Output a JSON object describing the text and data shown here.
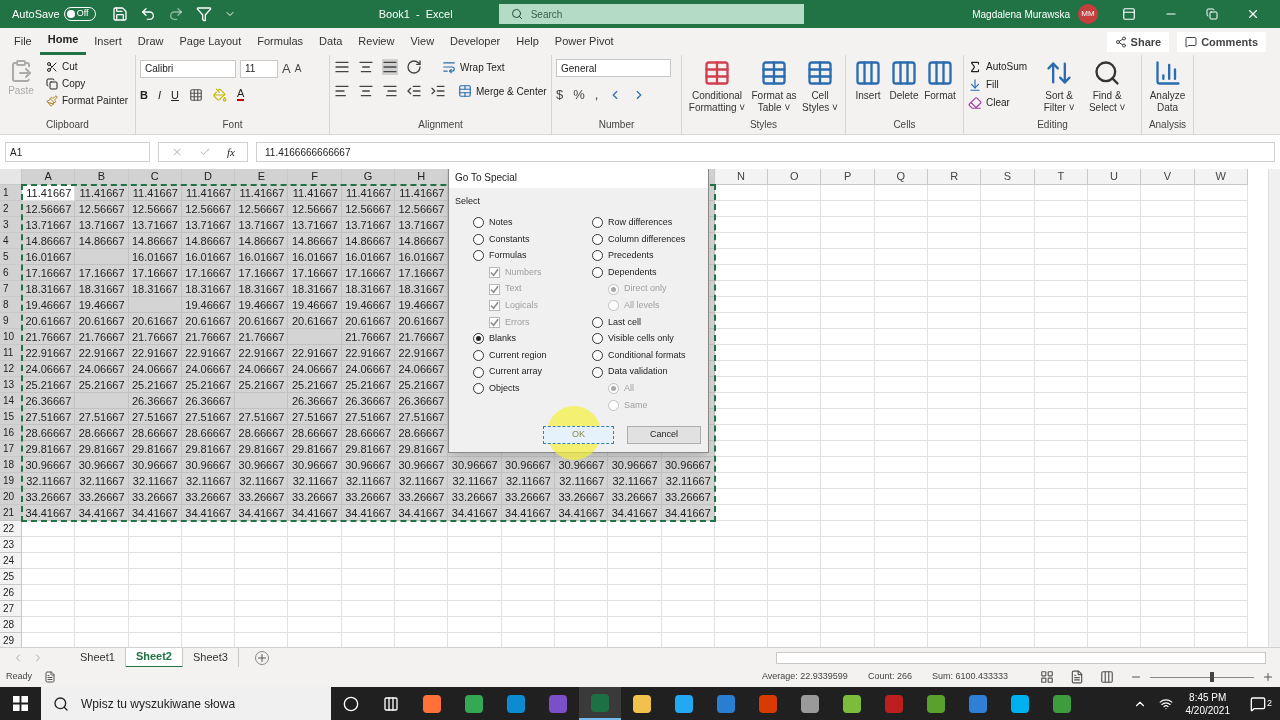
{
  "title_bar": {
    "autosave": "AutoSave",
    "toggle": {
      "label": "Off",
      "on": false
    },
    "title": "Book1  -  Excel",
    "search": {
      "placeholder": "Search"
    },
    "user": "Magdalena Murawska",
    "avatar": "MM"
  },
  "menu_tabs": [
    {
      "label": "File",
      "selected": false
    },
    {
      "label": "Home",
      "selected": true
    },
    {
      "label": "Insert",
      "selected": false
    },
    {
      "label": "Draw",
      "selected": false
    },
    {
      "label": "Page Layout",
      "selected": false
    },
    {
      "label": "Formulas",
      "selected": false
    },
    {
      "label": "Data",
      "selected": false
    },
    {
      "label": "Review",
      "selected": false
    },
    {
      "label": "View",
      "selected": false
    },
    {
      "label": "Developer",
      "selected": false
    },
    {
      "label": "Help",
      "selected": false
    },
    {
      "label": "Power Pivot",
      "selected": false
    }
  ],
  "share": "Share",
  "comments": "Comments",
  "clipboard": {
    "label": "Clipboard",
    "paste": {
      "label": "Paste",
      "disabled": true
    },
    "cut": "Cut",
    "copy": "Copy",
    "format_painter": "Format Painter"
  },
  "font": {
    "label": "Font",
    "family": "Calibri",
    "size": "11",
    "grow": "A",
    "shrink": "A",
    "bold": "B",
    "italic": "I",
    "underline": "U",
    "font_color_letter": "A"
  },
  "alignment": {
    "label": "Alignment",
    "wrap": "Wrap Text",
    "merge": "Merge & Center"
  },
  "number": {
    "label": "Number",
    "format": "General",
    "symbols": [
      "$",
      "%",
      ","
    ]
  },
  "styles": {
    "label": "Styles",
    "buttons": [
      "Conditional Formatting ˅",
      "Format as Table ˅",
      "Cell Styles ˅"
    ]
  },
  "cells": {
    "label": "Cells",
    "buttons": [
      "Insert",
      "Delete",
      "Format"
    ]
  },
  "editing": {
    "label": "Editing",
    "autosum": "AutoSum",
    "fill": "Fill",
    "clear": "Clear",
    "buttons": [
      "Sort & Filter ˅",
      "Find & Select ˅"
    ]
  },
  "analysis": {
    "label": "Analysis",
    "buttons": [
      "Analyze Data"
    ]
  },
  "formula_bar": {
    "name_box": "A1",
    "fx": "fx",
    "formula": "11.4166666666667"
  },
  "columns": [
    {
      "label": "A",
      "selected": true
    },
    {
      "label": "B",
      "selected": true
    },
    {
      "label": "C",
      "selected": true
    },
    {
      "label": "D",
      "selected": true
    },
    {
      "label": "E",
      "selected": true
    },
    {
      "label": "F",
      "selected": true
    },
    {
      "label": "G",
      "selected": true
    },
    {
      "label": "H",
      "selected": true
    },
    {
      "selected": true
    },
    {
      "selected": true
    },
    {
      "selected": true
    },
    {
      "selected": true
    },
    {
      "selected": true
    },
    {
      "label": "N",
      "selected": false
    },
    {
      "label": "O",
      "selected": false
    },
    {
      "label": "P",
      "selected": false
    },
    {
      "label": "Q",
      "selected": false
    },
    {
      "label": "R",
      "selected": false
    },
    {
      "label": "S",
      "selected": false
    },
    {
      "label": "T",
      "selected": false
    },
    {
      "label": "U",
      "selected": false
    },
    {
      "label": "V",
      "selected": false
    },
    {
      "label": "W",
      "selected": false
    }
  ],
  "rows": [
    {
      "number": "1",
      "selected": true,
      "cells": [
        {
          "value": "11.41667",
          "active": true
        },
        "11.41667",
        "11.41667",
        "11.41667",
        "11.41667",
        "11.41667",
        "11.41667",
        "11.41667"
      ]
    },
    {
      "number": "2",
      "selected": true,
      "cells": [
        "12.56667",
        "12.56667",
        "12.56667",
        "12.56667",
        "12.56667",
        "12.56667",
        "12.56667",
        "12.56667"
      ]
    },
    {
      "number": "3",
      "selected": true,
      "cells": [
        "13.71667",
        "13.71667",
        "13.71667",
        "13.71667",
        "13.71667",
        "13.71667",
        "13.71667",
        "13.71667"
      ]
    },
    {
      "number": "4",
      "selected": true,
      "cells": [
        "14.86667",
        "14.86667",
        "14.86667",
        "14.86667",
        "14.86667",
        "14.86667",
        "14.86667",
        "14.86667"
      ]
    },
    {
      "number": "5",
      "selected": true,
      "cells": [
        "16.01667",
        null,
        "16.01667",
        "16.01667",
        "16.01667",
        "16.01667",
        "16.01667",
        "16.01667"
      ]
    },
    {
      "number": "6",
      "selected": true,
      "cells": [
        "17.16667",
        "17.16667",
        "17.16667",
        "17.16667",
        "17.16667",
        "17.16667",
        "17.16667",
        "17.16667"
      ]
    },
    {
      "number": "7",
      "selected": true,
      "cells": [
        "18.31667",
        "18.31667",
        "18.31667",
        "18.31667",
        "18.31667",
        "18.31667",
        "18.31667",
        "18.31667"
      ]
    },
    {
      "number": "8",
      "selected": true,
      "cells": [
        "19.46667",
        "19.46667",
        null,
        "19.46667",
        "19.46667",
        "19.46667",
        "19.46667",
        "19.46667"
      ]
    },
    {
      "number": "9",
      "selected": true,
      "cells": [
        "20.61667",
        "20.61667",
        "20.61667",
        "20.61667",
        "20.61667",
        "20.61667",
        "20.61667",
        "20.61667"
      ]
    },
    {
      "number": "10",
      "selected": true,
      "cells": [
        "21.76667",
        "21.76667",
        "21.76667",
        "21.76667",
        "21.76667",
        null,
        "21.76667",
        "21.76667"
      ]
    },
    {
      "number": "11",
      "selected": true,
      "cells": [
        "22.91667",
        "22.91667",
        "22.91667",
        "22.91667",
        "22.91667",
        "22.91667",
        "22.91667",
        "22.91667"
      ]
    },
    {
      "number": "12",
      "selected": true,
      "cells": [
        "24.06667",
        "24.06667",
        "24.06667",
        "24.06667",
        "24.06667",
        "24.06667",
        "24.06667",
        "24.06667"
      ]
    },
    {
      "number": "13",
      "selected": true,
      "cells": [
        "25.21667",
        "25.21667",
        "25.21667",
        "25.21667",
        "25.21667",
        "25.21667",
        "25.21667",
        "25.21667"
      ]
    },
    {
      "number": "14",
      "selected": true,
      "cells": [
        "26.36667",
        null,
        "26.36667",
        "26.36667",
        null,
        "26.36667",
        "26.36667",
        "26.36667"
      ]
    },
    {
      "number": "15",
      "selected": true,
      "cells": [
        "27.51667",
        "27.51667",
        "27.51667",
        "27.51667",
        "27.51667",
        "27.51667",
        "27.51667",
        "27.51667"
      ]
    },
    {
      "number": "16",
      "selected": true,
      "cells": [
        "28.66667",
        "28.66667",
        "28.66667",
        "28.66667",
        "28.66667",
        "28.66667",
        "28.66667",
        "28.66667"
      ]
    },
    {
      "number": "17",
      "selected": true,
      "cells": [
        "29.81667",
        "29.81667",
        "29.81667",
        "29.81667",
        "29.81667",
        "29.81667",
        "29.81667",
        "29.81667"
      ]
    },
    {
      "number": "18",
      "selected": true,
      "cells": [
        "30.96667",
        "30.96667",
        "30.96667",
        "30.96667",
        "30.96667",
        "30.96667",
        "30.96667",
        "30.96667",
        "30.96667",
        "30.96667",
        "30.96667",
        "30.96667",
        "30.96667"
      ]
    },
    {
      "number": "19",
      "selected": true,
      "cells": [
        "32.11667",
        "32.11667",
        "32.11667",
        "32.11667",
        "32.11667",
        "32.11667",
        "32.11667",
        "32.11667",
        "32.11667",
        "32.11667",
        "32.11667",
        "32.11667",
        "32.11667"
      ]
    },
    {
      "number": "20",
      "selected": true,
      "cells": [
        "33.26667",
        "33.26667",
        "33.26667",
        "33.26667",
        "33.26667",
        "33.26667",
        "33.26667",
        "33.26667",
        "33.26667",
        "33.26667",
        "33.26667",
        "33.26667",
        "33.26667"
      ]
    },
    {
      "number": "21",
      "selected": true,
      "cells": [
        "34.41667",
        "34.41667",
        "34.41667",
        "34.41667",
        "34.41667",
        "34.41667",
        "34.41667",
        "34.41667",
        "34.41667",
        "34.41667",
        "34.41667",
        "34.41667",
        "34.41667"
      ]
    },
    {
      "number": "22",
      "selected": false,
      "cells": []
    },
    {
      "number": "23",
      "selected": false,
      "cells": []
    },
    {
      "number": "24",
      "selected": false,
      "cells": []
    },
    {
      "number": "25",
      "selected": false,
      "cells": []
    },
    {
      "number": "26",
      "selected": false,
      "cells": []
    },
    {
      "number": "27",
      "selected": false,
      "cells": []
    },
    {
      "number": "28",
      "selected": false,
      "cells": []
    },
    {
      "number": "29",
      "selected": false,
      "cells": []
    }
  ],
  "dialog": {
    "title": "Go To Special",
    "group": "Select",
    "left": [
      {
        "kind": "radio",
        "label": "Notes",
        "selected": false,
        "disabled": false
      },
      {
        "kind": "radio",
        "label": "Constants",
        "selected": false,
        "disabled": false
      },
      {
        "kind": "radio",
        "label": "Formulas",
        "selected": false,
        "disabled": false,
        "children": [
          {
            "kind": "checkbox",
            "label": "Numbers",
            "checked": true,
            "disabled": true
          },
          {
            "kind": "checkbox",
            "label": "Text",
            "checked": true,
            "disabled": true
          },
          {
            "kind": "checkbox",
            "label": "Logicals",
            "checked": true,
            "disabled": true
          },
          {
            "kind": "checkbox",
            "label": "Errors",
            "checked": true,
            "disabled": true
          }
        ]
      },
      {
        "kind": "radio",
        "label": "Blanks",
        "selected": true,
        "disabled": false
      },
      {
        "kind": "radio",
        "label": "Current region",
        "selected": false,
        "disabled": false
      },
      {
        "kind": "radio",
        "label": "Current array",
        "selected": false,
        "disabled": false
      },
      {
        "kind": "radio",
        "label": "Objects",
        "selected": false,
        "disabled": false
      }
    ],
    "right": [
      {
        "kind": "radio",
        "label": "Row differences",
        "selected": false,
        "disabled": false
      },
      {
        "kind": "radio",
        "label": "Column differences",
        "selected": false,
        "disabled": false
      },
      {
        "kind": "radio",
        "label": "Precedents",
        "selected": false,
        "disabled": false
      },
      {
        "kind": "radio",
        "label": "Dependents",
        "selected": false,
        "disabled": false,
        "children": [
          {
            "kind": "radio",
            "label": "Direct only",
            "selected": true,
            "disabled": true
          },
          {
            "kind": "radio",
            "label": "All levels",
            "selected": false,
            "disabled": true
          }
        ]
      },
      {
        "kind": "radio",
        "label": "Last cell",
        "selected": false,
        "disabled": false
      },
      {
        "kind": "radio",
        "label": "Visible cells only",
        "selected": false,
        "disabled": false
      },
      {
        "kind": "radio",
        "label": "Conditional formats",
        "selected": false,
        "disabled": false
      },
      {
        "kind": "radio",
        "label": "Data validation",
        "selected": false,
        "disabled": false,
        "children": [
          {
            "kind": "radio",
            "label": "All",
            "selected": true,
            "disabled": true
          },
          {
            "kind": "radio",
            "label": "Same",
            "selected": false,
            "disabled": true
          }
        ]
      }
    ],
    "ok": "OK",
    "cancel": "Cancel"
  },
  "sheets": [
    {
      "label": "Sheet1",
      "selected": false
    },
    {
      "label": "Sheet2",
      "selected": true
    },
    {
      "label": "Sheet3",
      "selected": false
    }
  ],
  "status_bar": {
    "ready": "Ready",
    "average": "Average: 22.9339599",
    "count": "Count: 266",
    "sum": "Sum: 6100.433333",
    "zoom": {
      "level": 0.6
    }
  },
  "taskbar": {
    "search": {
      "placeholder": "Wpisz tu wyszukiwane słowa"
    },
    "apps": [
      {
        "color": "#ff7139",
        "active": false
      },
      {
        "color": "#34a853",
        "active": false
      },
      {
        "color": "#0c8bd0",
        "active": false
      },
      {
        "color": "#7b4fc7",
        "active": false
      },
      {
        "color": "#1d7044",
        "active": true
      },
      {
        "color": "#f0c14b",
        "active": false
      },
      {
        "color": "#23a8f2",
        "active": false
      },
      {
        "color": "#2a7ed2",
        "active": false
      },
      {
        "color": "#d83b01",
        "active": false
      },
      {
        "color": "#9a9a9a",
        "active": false
      },
      {
        "color": "#7bbd3b",
        "active": false
      },
      {
        "color": "#bf1e1e",
        "active": false
      },
      {
        "color": "#5aa02c",
        "active": false
      },
      {
        "color": "#2f7fd6",
        "active": false
      },
      {
        "color": "#00aff0",
        "active": false
      },
      {
        "color": "#3d9c3d",
        "active": false
      }
    ],
    "time": "8:45 PM",
    "date": "4/20/2021",
    "notifications": "2"
  }
}
